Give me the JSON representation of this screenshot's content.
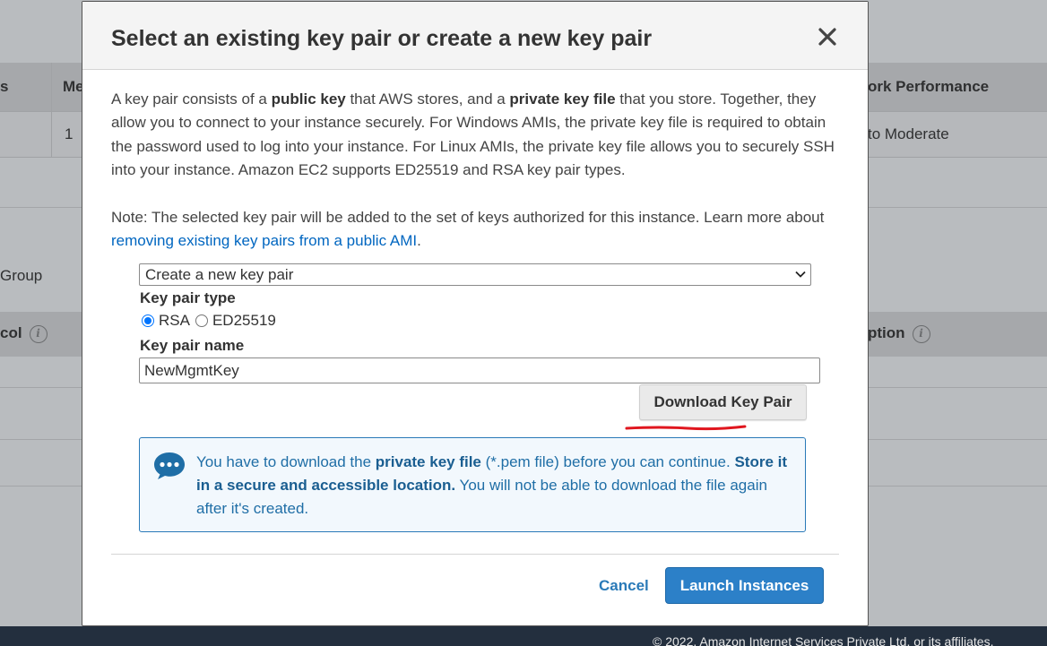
{
  "background": {
    "columns_top": {
      "left_partial": "s",
      "memory_partial": "Me",
      "network_partial": "ork Performance"
    },
    "row": {
      "count": "1",
      "network_value_partial": "to Moderate"
    },
    "group_label_partial": "Group",
    "columns_bottom": {
      "protocol_partial": "col",
      "description_partial": "ption"
    },
    "footer_text": "© 2022, Amazon Internet Services Private Ltd. or its affiliates."
  },
  "modal": {
    "title": "Select an existing key pair or create a new key pair",
    "description": {
      "t1": "A key pair consists of a ",
      "b1": "public key",
      "t2": " that AWS stores, and a ",
      "b2": "private key file",
      "t3": " that you store. Together, they allow you to connect to your instance securely. For Windows AMIs, the private key file is required to obtain the password used to log into your instance. For Linux AMIs, the private key file allows you to securely SSH into your instance. Amazon EC2 supports ED25519 and RSA key pair types."
    },
    "note": {
      "text": "Note: The selected key pair will be added to the set of keys authorized for this instance. Learn more about ",
      "link": "removing existing key pairs from a public AMI",
      "end": "."
    },
    "key_pair_select": {
      "value": "Create a new key pair"
    },
    "key_pair_type": {
      "label": "Key pair type",
      "options": [
        {
          "label": "RSA",
          "checked": true
        },
        {
          "label": "ED25519",
          "checked": false
        }
      ]
    },
    "key_pair_name": {
      "label": "Key pair name",
      "value": "NewMgmtKey"
    },
    "download_button": "Download Key Pair",
    "info": {
      "t1": "You have to download the ",
      "b1": "private key file",
      "t2": " (*.pem file) before you can continue. ",
      "b2": "Store it in a secure and accessible location.",
      "t3": " You will not be able to download the file again after it's created."
    },
    "cancel": "Cancel",
    "launch": "Launch Instances"
  },
  "colors": {
    "primary_button": "#2c80c8",
    "link": "#0066c0",
    "info_border": "#2a7ab8",
    "annotation": "#e0161e",
    "footer": "#232f3e"
  },
  "icons": {
    "close": "close-icon",
    "info_chat": "chat-bubble-icon",
    "select_chevron": "chevron-down-icon"
  }
}
